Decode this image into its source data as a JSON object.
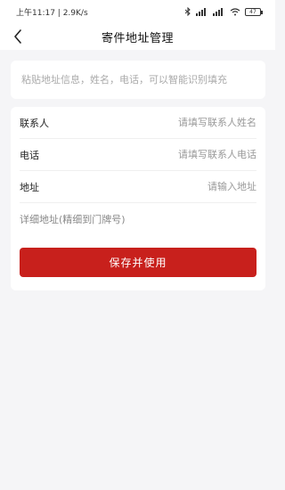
{
  "status_bar": {
    "time": "上午11:17 | 2.9K/s",
    "battery": "47"
  },
  "nav": {
    "title": "寄件地址管理"
  },
  "paste": {
    "placeholder": "粘贴地址信息，姓名，电话，可以智能识别填充"
  },
  "form": {
    "contact": {
      "label": "联系人",
      "placeholder": "请填写联系人姓名"
    },
    "phone": {
      "label": "电话",
      "placeholder": "请填写联系人电话"
    },
    "address": {
      "label": "地址",
      "placeholder": "请输入地址"
    },
    "detail": {
      "placeholder": "详细地址(精细到门牌号)"
    },
    "save_label": "保存并使用"
  },
  "colors": {
    "accent": "#c8201c",
    "background": "#f5f5f7"
  }
}
